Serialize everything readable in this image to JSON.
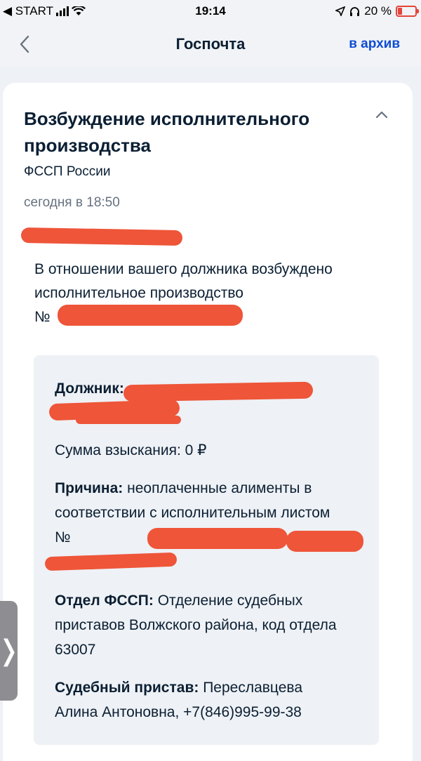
{
  "status_bar": {
    "carrier": "◀ START",
    "time": "19:14",
    "battery": "20 %"
  },
  "nav": {
    "title": "Госпочта",
    "archive_label": "в архив"
  },
  "card": {
    "title": "Возбуждение исполнительного производства",
    "sender": "ФССП России",
    "timestamp": "сегодня в 18:50",
    "message_line1": "В отношении вашего должника возбуждено",
    "message_line2": "исполнительное производство",
    "number_prefix": "№",
    "details": {
      "debtor_label": "Должник:",
      "sum_label": "Сумма взыскания:",
      "sum_value": "0 ₽",
      "reason_label": "Причина:",
      "reason_value": "неоплаченные алименты в соответствии с исполнительным листом №",
      "department_label": "Отдел ФССП:",
      "department_value": "Отделение судебных приставов Волжского района, код отдела 63007",
      "bailiff_label": "Судебный пристав:",
      "bailiff_value": "Переславцева Алина Антоновна, +7(846)995-99-38"
    }
  },
  "side_handle_glyph": "❭",
  "colors": {
    "accent": "#0d4cd3",
    "redaction": "#ee5539",
    "background": "#eef1f5"
  }
}
